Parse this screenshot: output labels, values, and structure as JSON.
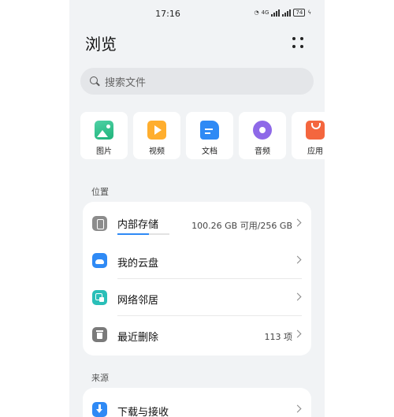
{
  "status_bar": {
    "time": "17:16",
    "network": "4G",
    "battery": "74"
  },
  "header": {
    "title": "浏览",
    "more_icon": "more-dots-icon"
  },
  "search": {
    "placeholder": "搜索文件"
  },
  "categories": [
    {
      "label": "图片",
      "icon": "photo-icon"
    },
    {
      "label": "视频",
      "icon": "video-icon"
    },
    {
      "label": "文档",
      "icon": "document-icon"
    },
    {
      "label": "音频",
      "icon": "audio-icon"
    },
    {
      "label": "应用",
      "icon": "app-icon"
    }
  ],
  "locations": {
    "label": "位置",
    "items": [
      {
        "name": "内部存储",
        "value": "100.26 GB 可用/256 GB",
        "icon": "phone-storage-icon",
        "usage_fraction": 0.61
      },
      {
        "name": "我的云盘",
        "value": "",
        "icon": "cloud-icon"
      },
      {
        "name": "网络邻居",
        "value": "",
        "icon": "network-icon"
      },
      {
        "name": "最近删除",
        "value": "113 项",
        "icon": "trash-icon"
      }
    ]
  },
  "sources": {
    "label": "来源",
    "items": [
      {
        "name": "下载与接收",
        "value": "",
        "icon": "download-icon"
      }
    ]
  },
  "colors": {
    "accent": "#2f8af5",
    "background": "#f1f3f5"
  }
}
